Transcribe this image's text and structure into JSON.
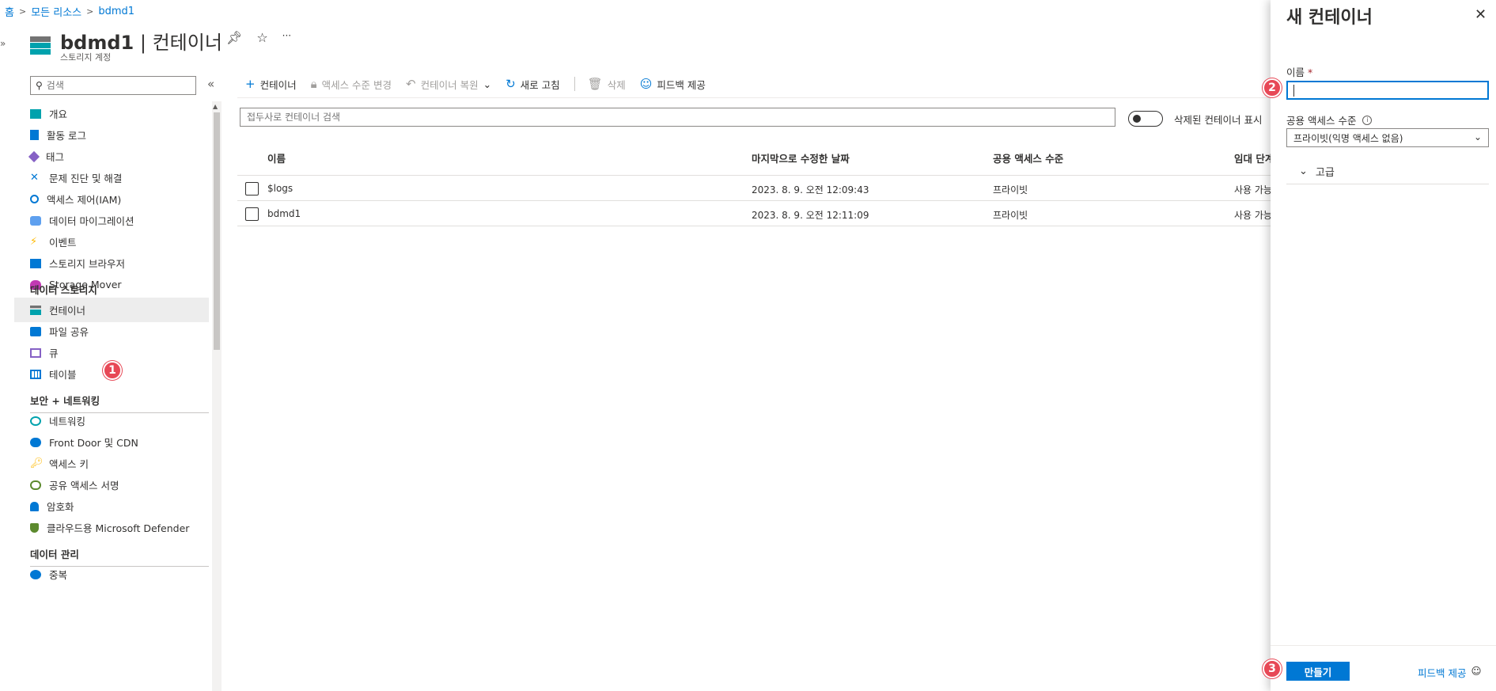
{
  "breadcrumb": {
    "home": "홈",
    "all_resources": "모든 리소스",
    "current": "bdmd1"
  },
  "header": {
    "resource_name": "bdmd1",
    "separator": " | ",
    "page_name": "컨테이너",
    "subtitle": "스토리지 계정",
    "more": "···"
  },
  "sidebar": {
    "search_placeholder": "검색",
    "items_top": [
      {
        "label": "개요",
        "icon": "overview-icon",
        "color": "#00a2ad"
      },
      {
        "label": "활동 로그",
        "icon": "activity-log-icon",
        "color": "#0078d4"
      },
      {
        "label": "태그",
        "icon": "tag-icon",
        "color": "#8661c5"
      },
      {
        "label": "문제 진단 및 해결",
        "icon": "wrench-icon",
        "color": "#0078d4"
      },
      {
        "label": "액세스 제어(IAM)",
        "icon": "people-icon",
        "color": "#0078d4"
      },
      {
        "label": "데이터 마이그레이션",
        "icon": "migration-icon",
        "color": "#5ea0ef"
      },
      {
        "label": "이벤트",
        "icon": "lightning-icon",
        "color": "#ffb900"
      },
      {
        "label": "스토리지 브라우저",
        "icon": "storage-browser-icon",
        "color": "#0078d4"
      },
      {
        "label": "Storage Mover",
        "icon": "storage-mover-icon",
        "color": "#c239b3"
      }
    ],
    "group_data_storage": "데이터 스토리지",
    "items_storage": [
      {
        "label": "컨테이너",
        "icon": "container-icon",
        "color": "#00a2ad"
      },
      {
        "label": "파일 공유",
        "icon": "file-share-icon",
        "color": "#0078d4"
      },
      {
        "label": "큐",
        "icon": "queue-icon",
        "color": "#8661c5"
      },
      {
        "label": "테이블",
        "icon": "table-icon",
        "color": "#0078d4"
      }
    ],
    "group_security": "보안 + 네트워킹",
    "items_security": [
      {
        "label": "네트워킹",
        "icon": "networking-icon",
        "color": "#00a2ad"
      },
      {
        "label": "Front Door 및 CDN",
        "icon": "cloud-icon",
        "color": "#0078d4"
      },
      {
        "label": "액세스 키",
        "icon": "key-icon",
        "color": "#ffb900"
      },
      {
        "label": "공유 액세스 서명",
        "icon": "link-icon",
        "color": "#5c8a2e"
      },
      {
        "label": "암호화",
        "icon": "lock-icon",
        "color": "#0078d4"
      },
      {
        "label": "클라우드용 Microsoft Defender",
        "icon": "shield-icon",
        "color": "#5c8a2e"
      }
    ],
    "group_data_management": "데이터 관리",
    "items_management": [
      {
        "label": "중복",
        "icon": "redundancy-icon",
        "color": "#0078d4"
      }
    ]
  },
  "toolbar": {
    "add_container": "컨테이너",
    "change_access": "액세스 수준 변경",
    "restore": "컨테이너 복원",
    "refresh": "새로 고침",
    "delete": "삭제",
    "feedback": "피드백 제공"
  },
  "filter": {
    "placeholder": "접두사로 컨테이너 검색",
    "toggle_label": "삭제된 컨테이너 표시"
  },
  "table": {
    "columns": [
      "이름",
      "마지막으로 수정한 날짜",
      "공용 액세스 수준",
      "임대 단계"
    ],
    "rows": [
      {
        "name": "$logs",
        "modified": "2023. 8. 9. 오전 12:09:43",
        "access": "프라이빗",
        "lease": "사용 가능"
      },
      {
        "name": "bdmd1",
        "modified": "2023. 8. 9. 오전 12:11:09",
        "access": "프라이빗",
        "lease": "사용 가능"
      }
    ]
  },
  "panel": {
    "title": "새 컨테이너",
    "name_label": "이름",
    "required_mark": "*",
    "name_value": "",
    "access_label": "공용 액세스 수준",
    "access_value": "프라이빗(익명 액세스 없음)",
    "advanced": "고급",
    "create_button": "만들기",
    "feedback": "피드백 제공"
  },
  "badges": {
    "one": "1",
    "two": "2",
    "three": "3"
  },
  "colors": {
    "accent": "#0078d4",
    "badge": "#e74856"
  }
}
